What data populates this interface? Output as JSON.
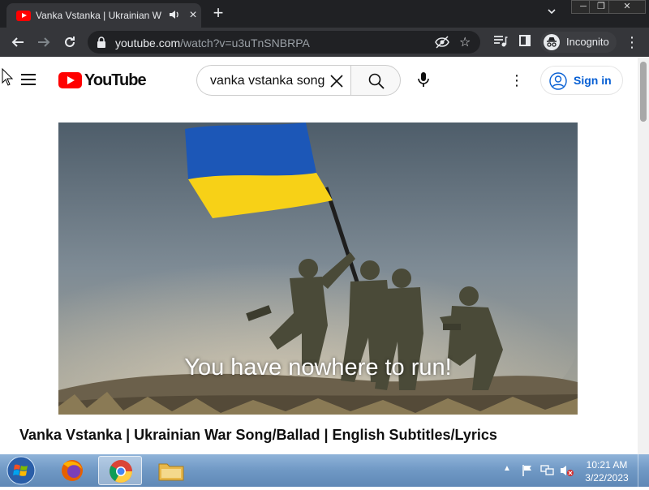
{
  "browser": {
    "tab_title": "Vanka Vstanka | Ukrainian W",
    "new_tab_label": "+",
    "window_controls": {
      "minimize": "─",
      "maximize": "❐",
      "close": "✕"
    },
    "url_host": "youtube.com",
    "url_path": "/watch?v=u3uTnSNBRPA",
    "profile_label": "Incognito"
  },
  "youtube": {
    "logo_text": "YouTube",
    "search_value": "vanka vstanka song",
    "signin_label": "Sign in"
  },
  "video": {
    "subtitle": "You have nowhere to run!",
    "title": "Vanka Vstanka | Ukrainian War Song/Ballad | English Subtitles/Lyrics"
  },
  "taskbar": {
    "time": "10:21 AM",
    "date": "3/22/2023"
  },
  "colors": {
    "youtube_red": "#ff0000",
    "signin_blue": "#065fd4",
    "flag_blue": "#1c57b7",
    "flag_yellow": "#f7d117"
  }
}
